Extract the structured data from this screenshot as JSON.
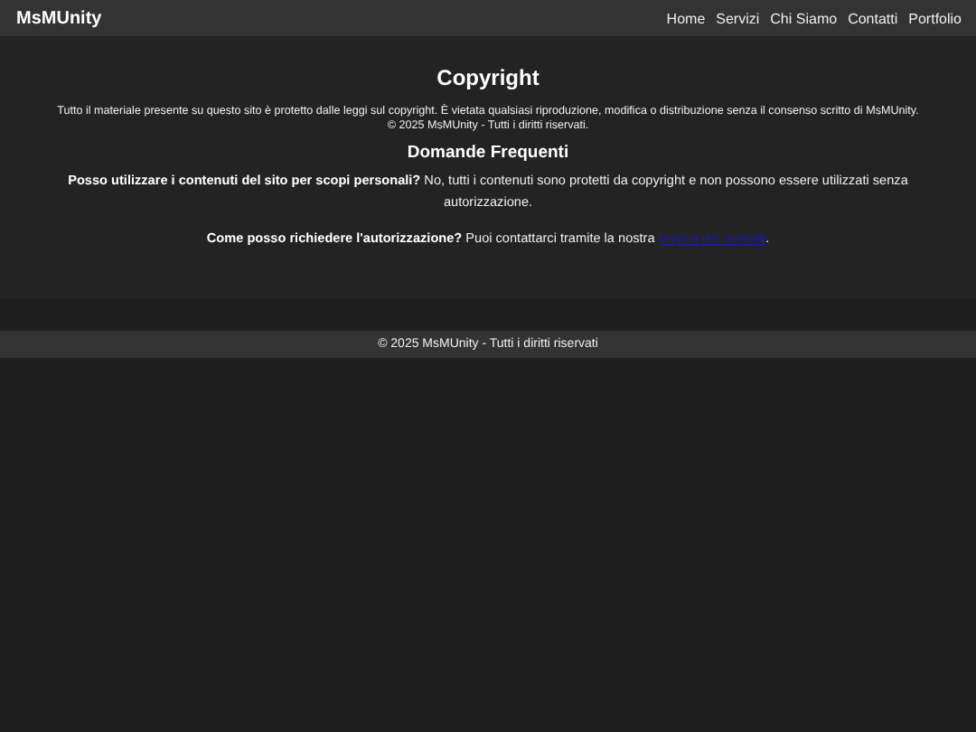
{
  "header": {
    "brand": "MsMUnity",
    "nav": [
      "Home",
      "Servizi",
      "Chi Siamo",
      "Contatti",
      "Portfolio"
    ]
  },
  "main": {
    "title": "Copyright",
    "notice": "Tutto il materiale presente su questo sito è protetto dalle leggi sul copyright. È vietata qualsiasi riproduzione, modifica o distribuzione senza il consenso scritto di MsMUnity.",
    "rights": "© 2025 MsMUnity - Tutti i diritti riservati.",
    "faq_title": "Domande Frequenti",
    "faqs": [
      {
        "text": "**Posso utilizzare i contenuti del sito per scopi personali?** No, tutti i contenuti sono protetti da copyright e non possono essere utilizzati senza autorizzazione."
      },
      {
        "text": "**Come posso richiedere l'autorizzazione?** Puoi contattarci tramite la nostra ",
        "link": "pagina dei contatti",
        "after": "."
      }
    ]
  },
  "footer": "© 2025 MsMUnity - Tutti i diritti riservati"
}
